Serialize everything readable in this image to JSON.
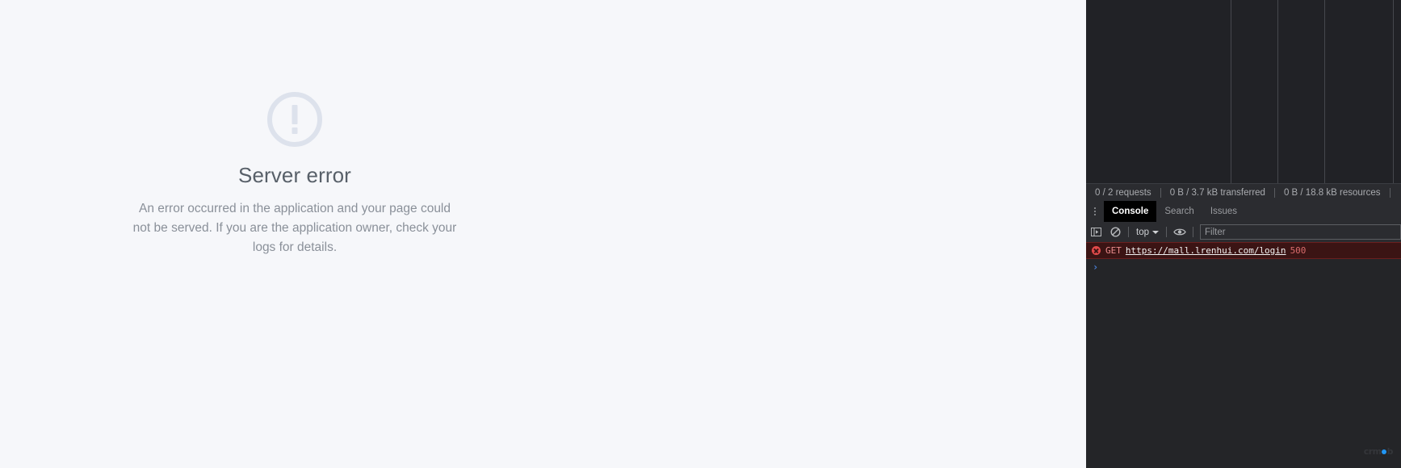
{
  "page": {
    "icon_name": "alert-circle-icon",
    "title": "Server error",
    "description": "An error occurred in the application and your page could not be served. If you are the application owner, check your logs for details."
  },
  "devtools": {
    "network_summary": {
      "requests": "0 / 2 requests",
      "transferred": "0 B / 3.7 kB transferred",
      "resources": "0 B / 18.8 kB resources"
    },
    "drawer_tabs": [
      {
        "label": "Console",
        "active": true
      },
      {
        "label": "Search",
        "active": false
      },
      {
        "label": "Issues",
        "active": false
      }
    ],
    "more_tabs_icon": "more-vertical-icon",
    "console_toolbar": {
      "sidebar_toggle_icon": "console-sidebar-icon",
      "clear_icon": "clear-console-icon",
      "context": "top",
      "context_caret_icon": "chevron-down-icon",
      "eye_icon": "live-expression-eye-icon",
      "filter_placeholder": "Filter",
      "filter_value": ""
    },
    "console_messages": [
      {
        "level": "error",
        "level_icon": "error-circle-icon",
        "method": "GET",
        "url": "https://mall.lrenhui.com/login",
        "status": "500"
      }
    ],
    "prompt_glyph": "›",
    "watermark": {
      "before": "crm",
      "after": "b"
    }
  },
  "colors": {
    "page_bg": "#f6f7fa",
    "icon": "#dde2ec",
    "title": "#586069",
    "body_text": "#8a9099",
    "devtools_bg": "#212226",
    "toolbar_bg": "#2b2c30",
    "console_bg": "#242528",
    "error_row_bg": "#3b1414",
    "error_red": "#e24a4a",
    "accent_blue": "#2196f3"
  }
}
